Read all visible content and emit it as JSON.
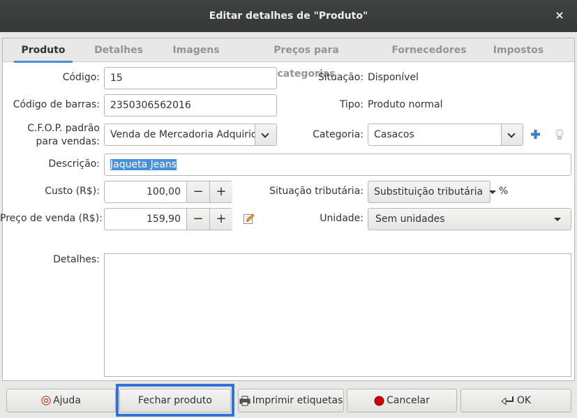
{
  "window": {
    "title": "Editar detalhes de \"Produto\"",
    "close_glyph": "×"
  },
  "tabs": [
    {
      "label": "Produto",
      "active": true
    },
    {
      "label": "Detalhes"
    },
    {
      "label": "Imagens"
    },
    {
      "label": "Preços para categorias"
    },
    {
      "label": "Fornecedores"
    },
    {
      "label": "Impostos"
    }
  ],
  "form": {
    "codigo": {
      "label": "Código:",
      "value": "15"
    },
    "barras": {
      "label": "Código de barras:",
      "value": "2350306562016"
    },
    "cfop": {
      "label_line1": "C.F.O.P. padrão",
      "label_line2": "para vendas:",
      "value": "Venda de Mercadoria Adquirida"
    },
    "descricao": {
      "label": "Descrição:",
      "value": "Jaqueta Jeans"
    },
    "custo": {
      "label": "Custo (R$):",
      "value": "100,00"
    },
    "preco": {
      "label": "Preço de venda (R$):",
      "value": "159,90"
    },
    "detalhes": {
      "label": "Detalhes:",
      "value": ""
    },
    "situacao": {
      "label": "Situação:",
      "value": "Disponível"
    },
    "tipo": {
      "label": "Tipo:",
      "value": "Produto normal"
    },
    "categoria": {
      "label": "Categoria:",
      "value": "Casacos"
    },
    "situacao_tributaria": {
      "label": "Situação tributária:",
      "value": "Substituição tributária",
      "suffix": "%"
    },
    "unidade": {
      "label": "Unidade:",
      "value": "Sem unidades"
    },
    "spin_minus": "−",
    "spin_plus": "+"
  },
  "buttons": {
    "ajuda": "Ajuda",
    "fechar": "Fechar produto",
    "imprimir": "Imprimir etiquetas",
    "cancelar": "Cancelar",
    "ok": "OK"
  },
  "colors": {
    "accent": "#4a90d9",
    "focus": "#2f74d6",
    "titlebar": "#393b39",
    "cancel_red": "#cc0000"
  }
}
